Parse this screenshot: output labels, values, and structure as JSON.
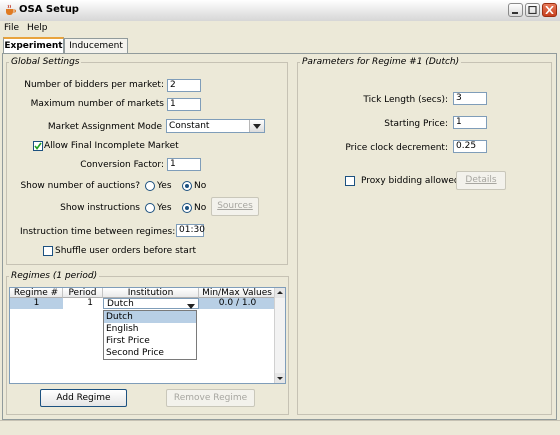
{
  "window": {
    "title": "OSA Setup"
  },
  "menu": [
    {
      "label": "File"
    },
    {
      "label": "Help"
    }
  ],
  "tabs": [
    {
      "label": "Experiment",
      "active": true
    },
    {
      "label": "Inducement",
      "active": false
    }
  ],
  "global_settings": {
    "title": "Global Settings",
    "bidders_label": "Number of bidders per market:",
    "bidders_value": "2",
    "max_markets_label": "Maximum number of markets",
    "max_markets_value": "1",
    "assignment_label": "Market Assignment Mode",
    "assignment_value": "Constant",
    "allow_final_label": "Allow Final Incomplete Market",
    "allow_final_checked": true,
    "conversion_label": "Conversion Factor:",
    "conversion_value": "1",
    "show_auctions_label": "Show number of auctions?",
    "show_auctions_selected": "No",
    "show_instructions_label": "Show instructions",
    "show_instructions_selected": "No",
    "yes_label": "Yes",
    "no_label": "No",
    "sources_label": "Sources",
    "instruction_time_label": "Instruction time between regimes:",
    "instruction_time_value": "01:30",
    "shuffle_label": "Shuffle user orders before start",
    "shuffle_checked": false
  },
  "regimes": {
    "title": "Regimes (1 period)",
    "columns": [
      "Regime #",
      "Period",
      "Institution",
      "Min/Max Values"
    ],
    "rows": [
      {
        "regime": "1",
        "period": "1",
        "institution": "Dutch",
        "minmax": "0.0 / 1.0"
      }
    ],
    "dropdown_options": [
      "Dutch",
      "English",
      "First Price",
      "Second Price"
    ],
    "dropdown_highlighted": "Dutch",
    "add_label": "Add Regime",
    "remove_label": "Remove Regime"
  },
  "params": {
    "title": "Parameters for Regime #1 (Dutch)",
    "tick_label": "Tick Length (secs):",
    "tick_value": "3",
    "start_label": "Starting Price:",
    "start_value": "1",
    "decrement_label": "Price clock decrement:",
    "decrement_value": "0.25",
    "proxy_label": "Proxy bidding allowed",
    "proxy_checked": false,
    "details_label": "Details"
  },
  "colors": {
    "accent_tab": "#e8a33d",
    "selection": "#b8cfe5",
    "window_bg": "#ece9d8"
  }
}
